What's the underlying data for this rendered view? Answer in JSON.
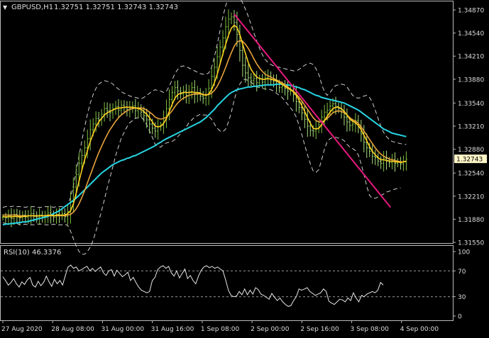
{
  "window": {
    "symbol_label": "GBPUSD,H1",
    "ohlc_label": "1.32751 1.32751 1.32743 1.32743",
    "triangle_glyph": "▼"
  },
  "chart_data": [
    {
      "type": "line",
      "title": "GBPUSD,H1 1.32751 1.32751 1.32743 1.32743",
      "x_tick_labels": [
        "27 Aug 2020",
        "28 Aug 08:00",
        "31 Aug 00:00",
        "31 Aug 16:00",
        "1 Sep 08:00",
        "2 Sep 00:00",
        "2 Sep 16:00",
        "3 Sep 08:00",
        "4 Sep 00:00"
      ],
      "y_tick_labels": [
        "1.34870",
        "1.34540",
        "1.34210",
        "1.33880",
        "1.33540",
        "1.33210",
        "1.32880",
        "1.32540",
        "1.32210",
        "1.31880",
        "1.31550"
      ],
      "ylim": [
        1.3155,
        1.3487
      ],
      "current_price_label": "1.32743",
      "series": [],
      "price_close": [
        1.3191,
        1.319,
        1.3193,
        1.3189,
        1.3195,
        1.3192,
        1.319,
        1.3194,
        1.3191,
        1.3193,
        1.3196,
        1.3192,
        1.3191,
        1.3194,
        1.319,
        1.3193,
        1.3197,
        1.3194,
        1.3191,
        1.3195,
        1.3193,
        1.3196,
        1.3192,
        1.3199,
        1.3213,
        1.3234,
        1.3252,
        1.3268,
        1.3279,
        1.329,
        1.3303,
        1.3316,
        1.3324,
        1.3332,
        1.333,
        1.3338,
        1.3346,
        1.3343,
        1.334,
        1.3346,
        1.3349,
        1.3344,
        1.3351,
        1.3348,
        1.3345,
        1.3347,
        1.335,
        1.3343,
        1.3346,
        1.3341,
        1.3336,
        1.333,
        1.3324,
        1.3318,
        1.3314,
        1.332,
        1.3322,
        1.3333,
        1.3346,
        1.3359,
        1.3369,
        1.3376,
        1.3371,
        1.3367,
        1.3371,
        1.3365,
        1.3369,
        1.3376,
        1.3366,
        1.3369,
        1.3364,
        1.3361,
        1.3366,
        1.3375,
        1.3392,
        1.3405,
        1.342,
        1.3434,
        1.3447,
        1.3463,
        1.3474,
        1.3477,
        1.3469,
        1.3452,
        1.3429,
        1.3408,
        1.3397,
        1.339,
        1.3386,
        1.3389,
        1.3383,
        1.3388,
        1.3384,
        1.339,
        1.3392,
        1.3387,
        1.3385,
        1.3381,
        1.3376,
        1.3378,
        1.3375,
        1.3371,
        1.3372,
        1.3366,
        1.3356,
        1.3348,
        1.334,
        1.3331,
        1.3321,
        1.3315,
        1.3314,
        1.3318,
        1.3323,
        1.3334,
        1.3341,
        1.3344,
        1.335,
        1.3353,
        1.3349,
        1.3346,
        1.3341,
        1.3334,
        1.3327,
        1.3322,
        1.3324,
        1.3329,
        1.332,
        1.331,
        1.3298,
        1.329,
        1.3285,
        1.3278,
        1.3276,
        1.3271,
        1.3268,
        1.3275,
        1.3271,
        1.3269,
        1.3273,
        1.3268,
        1.327,
        1.3267,
        1.327,
        1.3274
      ],
      "sma_fast": [
        1.3192,
        1.3191,
        1.3192,
        1.3191,
        1.3192,
        1.3192,
        1.3191,
        1.3192,
        1.3192,
        1.3193,
        1.3193,
        1.3193,
        1.3193,
        1.3193,
        1.3193,
        1.3193,
        1.3194,
        1.3194,
        1.3193,
        1.3194,
        1.3194,
        1.3194,
        1.3194,
        1.3196,
        1.32,
        1.321,
        1.3225,
        1.3242,
        1.3258,
        1.3273,
        1.3286,
        1.3299,
        1.331,
        1.332,
        1.3327,
        1.3332,
        1.3337,
        1.334,
        1.3342,
        1.3344,
        1.3346,
        1.3347,
        1.3347,
        1.3348,
        1.3348,
        1.3348,
        1.3348,
        1.3347,
        1.3346,
        1.3345,
        1.3342,
        1.3338,
        1.3333,
        1.3327,
        1.3321,
        1.332,
        1.3321,
        1.3325,
        1.3332,
        1.3342,
        1.3352,
        1.3361,
        1.3366,
        1.3368,
        1.3369,
        1.3369,
        1.3369,
        1.337,
        1.3369,
        1.3369,
        1.3368,
        1.3366,
        1.3365,
        1.3367,
        1.3373,
        1.3383,
        1.3395,
        1.341,
        1.3424,
        1.3438,
        1.3451,
        1.3461,
        1.3465,
        1.3462,
        1.3452,
        1.3438,
        1.3425,
        1.3412,
        1.3402,
        1.3396,
        1.3391,
        1.3389,
        1.3388,
        1.3388,
        1.3389,
        1.3388,
        1.3387,
        1.3386,
        1.3383,
        1.3381,
        1.3378,
        1.3375,
        1.3373,
        1.337,
        1.3365,
        1.3358,
        1.335,
        1.3342,
        1.3333,
        1.3325,
        1.3318,
        1.3317,
        1.3318,
        1.3323,
        1.3329,
        1.3335,
        1.3341,
        1.3346,
        1.3348,
        1.3348,
        1.3346,
        1.3342,
        1.3337,
        1.3331,
        1.3328,
        1.3326,
        1.3322,
        1.3316,
        1.3308,
        1.33,
        1.3292,
        1.3285,
        1.328,
        1.3276,
        1.3273,
        1.3273,
        1.3272,
        1.3271,
        1.3271,
        1.327,
        1.327,
        1.3269,
        1.327,
        1.3271
      ],
      "sma_slow": [
        1.3194,
        1.3194,
        1.3194,
        1.3194,
        1.3194,
        1.3194,
        1.3193,
        1.3193,
        1.3193,
        1.3193,
        1.3193,
        1.3193,
        1.3193,
        1.3193,
        1.3193,
        1.3193,
        1.3193,
        1.3193,
        1.3193,
        1.3193,
        1.3193,
        1.3193,
        1.3193,
        1.3194,
        1.3195,
        1.3198,
        1.3203,
        1.321,
        1.3219,
        1.3229,
        1.324,
        1.3251,
        1.3262,
        1.3273,
        1.3283,
        1.3292,
        1.3301,
        1.3309,
        1.3316,
        1.3322,
        1.3328,
        1.3333,
        1.3337,
        1.334,
        1.3343,
        1.3345,
        1.3346,
        1.3347,
        1.3347,
        1.3347,
        1.3346,
        1.3344,
        1.3341,
        1.3338,
        1.3334,
        1.3332,
        1.3331,
        1.3332,
        1.3334,
        1.3338,
        1.3343,
        1.3349,
        1.3354,
        1.3358,
        1.3361,
        1.3363,
        1.3365,
        1.3366,
        1.3367,
        1.3367,
        1.3367,
        1.3366,
        1.3366,
        1.3366,
        1.3368,
        1.3372,
        1.3378,
        1.3386,
        1.3395,
        1.3405,
        1.3416,
        1.3426,
        1.3435,
        1.3441,
        1.3443,
        1.3442,
        1.3438,
        1.3432,
        1.3425,
        1.3417,
        1.341,
        1.3404,
        1.3399,
        1.3395,
        1.3393,
        1.3391,
        1.3389,
        1.3387,
        1.3385,
        1.3383,
        1.338,
        1.3377,
        1.3374,
        1.3371,
        1.3367,
        1.3362,
        1.3357,
        1.3351,
        1.3345,
        1.3339,
        1.3333,
        1.3329,
        1.3327,
        1.3327,
        1.3329,
        1.3332,
        1.3336,
        1.334,
        1.3342,
        1.3343,
        1.3342,
        1.334,
        1.3337,
        1.3333,
        1.333,
        1.3328,
        1.3325,
        1.332,
        1.3314,
        1.3308,
        1.3302,
        1.3296,
        1.329,
        1.3285,
        1.3281,
        1.3278,
        1.3276,
        1.3274,
        1.3273,
        1.3272,
        1.3271,
        1.327,
        1.327,
        1.3271
      ],
      "ma_long": [
        1.318,
        1.3181,
        1.3181,
        1.3182,
        1.3182,
        1.3183,
        1.3183,
        1.3184,
        1.3184,
        1.3185,
        1.3186,
        1.3187,
        1.3188,
        1.3189,
        1.319,
        1.3191,
        1.3192,
        1.3194,
        1.3196,
        1.3198,
        1.32,
        1.3203,
        1.3206,
        1.3209,
        1.3212,
        1.3215,
        1.3218,
        1.3222,
        1.3226,
        1.323,
        1.3234,
        1.3238,
        1.3242,
        1.3246,
        1.325,
        1.3254,
        1.3257,
        1.326,
        1.3263,
        1.3266,
        1.3268,
        1.327,
        1.3272,
        1.3273,
        1.3275,
        1.3276,
        1.3278,
        1.3279,
        1.3281,
        1.3283,
        1.3285,
        1.3287,
        1.3289,
        1.3291,
        1.3293,
        1.3296,
        1.3298,
        1.3301,
        1.3303,
        1.3305,
        1.3307,
        1.3309,
        1.3311,
        1.3313,
        1.3315,
        1.3317,
        1.3319,
        1.3321,
        1.3323,
        1.3325,
        1.3327,
        1.333,
        1.3333,
        1.3337,
        1.3341,
        1.3345,
        1.335,
        1.3354,
        1.3358,
        1.3362,
        1.3366,
        1.3369,
        1.3371,
        1.3373,
        1.3374,
        1.3375,
        1.3376,
        1.3377,
        1.3377,
        1.3378,
        1.3378,
        1.3379,
        1.3379,
        1.338,
        1.338,
        1.338,
        1.338,
        1.3381,
        1.3381,
        1.3381,
        1.338,
        1.338,
        1.3379,
        1.3378,
        1.3377,
        1.3376,
        1.3374,
        1.3373,
        1.3371,
        1.3369,
        1.3367,
        1.3365,
        1.3364,
        1.3362,
        1.3361,
        1.336,
        1.3359,
        1.3358,
        1.3357,
        1.3356,
        1.3355,
        1.3354,
        1.3352,
        1.335,
        1.3348,
        1.3346,
        1.3344,
        1.3341,
        1.3338,
        1.3335,
        1.3332,
        1.3329,
        1.3326,
        1.3323,
        1.332,
        1.3317,
        1.3315,
        1.3313,
        1.3311,
        1.331,
        1.3309,
        1.3308,
        1.3307,
        1.3306
      ],
      "band_upper": [
        1.3205,
        1.3206,
        1.3207,
        1.3206,
        1.3207,
        1.3206,
        1.3206,
        1.3206,
        1.3205,
        1.3206,
        1.3206,
        1.3206,
        1.3205,
        1.3205,
        1.3205,
        1.3206,
        1.3206,
        1.3206,
        1.3205,
        1.3206,
        1.3206,
        1.3206,
        1.3205,
        1.3209,
        1.3219,
        1.3236,
        1.3256,
        1.3278,
        1.33,
        1.332,
        1.3338,
        1.3354,
        1.3366,
        1.3375,
        1.3381,
        1.3384,
        1.3386,
        1.3385,
        1.3384,
        1.3381,
        1.3377,
        1.3374,
        1.337,
        1.3368,
        1.3366,
        1.3364,
        1.3363,
        1.3362,
        1.3361,
        1.336,
        1.3362,
        1.3365,
        1.3368,
        1.3371,
        1.3373,
        1.3372,
        1.3371,
        1.3369,
        1.3371,
        1.3378,
        1.3387,
        1.3396,
        1.3402,
        1.3406,
        1.3407,
        1.3406,
        1.3404,
        1.3402,
        1.34,
        1.3398,
        1.3396,
        1.3395,
        1.3395,
        1.3397,
        1.3405,
        1.342,
        1.3438,
        1.3458,
        1.3477,
        1.3493,
        1.3505,
        1.3511,
        1.3512,
        1.351,
        1.3505,
        1.3497,
        1.3488,
        1.3478,
        1.3466,
        1.3454,
        1.3443,
        1.3432,
        1.3423,
        1.3416,
        1.3412,
        1.3409,
        1.3407,
        1.3406,
        1.3405,
        1.3404,
        1.3403,
        1.3402,
        1.3401,
        1.34,
        1.34,
        1.3402,
        1.3405,
        1.3408,
        1.341,
        1.3411,
        1.3409,
        1.3403,
        1.3395,
        1.3381,
        1.337,
        1.3365,
        1.3369,
        1.3375,
        1.3379,
        1.338,
        1.3381,
        1.338,
        1.3377,
        1.3371,
        1.3365,
        1.3362,
        1.3361,
        1.3362,
        1.3364,
        1.3365,
        1.3362,
        1.3355,
        1.3344,
        1.3332,
        1.3321,
        1.3312,
        1.3306,
        1.3302,
        1.3299,
        1.3298,
        1.3297,
        1.3296,
        1.3295,
        1.3295
      ],
      "band_lower": [
        1.3183,
        1.3182,
        1.3181,
        1.3182,
        1.3181,
        1.3182,
        1.318,
        1.318,
        1.3181,
        1.318,
        1.318,
        1.318,
        1.3181,
        1.3181,
        1.3181,
        1.318,
        1.318,
        1.318,
        1.3181,
        1.318,
        1.318,
        1.318,
        1.3181,
        1.3179,
        1.3171,
        1.316,
        1.315,
        1.3142,
        1.3138,
        1.3138,
        1.3142,
        1.3148,
        1.3158,
        1.3171,
        1.3185,
        1.32,
        1.3216,
        1.3233,
        1.3248,
        1.3263,
        1.3279,
        1.3292,
        1.3304,
        1.3312,
        1.332,
        1.3326,
        1.3329,
        1.3332,
        1.3333,
        1.3334,
        1.333,
        1.3323,
        1.3314,
        1.3305,
        1.3295,
        1.3292,
        1.3291,
        1.3295,
        1.3297,
        1.3298,
        1.3299,
        1.3302,
        1.3306,
        1.331,
        1.3315,
        1.332,
        1.3326,
        1.333,
        1.3334,
        1.3336,
        1.3338,
        1.3337,
        1.3337,
        1.3335,
        1.3331,
        1.3324,
        1.3318,
        1.3314,
        1.3313,
        1.3317,
        1.3327,
        1.3341,
        1.3358,
        1.3372,
        1.3381,
        1.3387,
        1.3388,
        1.3386,
        1.3384,
        1.338,
        1.3377,
        1.3376,
        1.3375,
        1.3374,
        1.3374,
        1.3373,
        1.3371,
        1.3368,
        1.3365,
        1.3362,
        1.3357,
        1.3352,
        1.3347,
        1.3342,
        1.3334,
        1.3322,
        1.3309,
        1.3294,
        1.328,
        1.3267,
        1.3257,
        1.3255,
        1.3259,
        1.3273,
        1.3288,
        1.3299,
        1.3303,
        1.3305,
        1.3305,
        1.3304,
        1.3303,
        1.33,
        1.3295,
        1.3291,
        1.3289,
        1.3286,
        1.328,
        1.3267,
        1.3252,
        1.3235,
        1.3222,
        1.3218,
        1.3218,
        1.322,
        1.3222,
        1.3224,
        1.3227,
        1.3228,
        1.323,
        1.3231,
        1.3232,
        1.3233
      ],
      "trendline": {
        "from": [
          82,
          1.3481
        ],
        "to": [
          147,
          1.3205
        ]
      }
    },
    {
      "type": "line",
      "title": "RSI(10) 46.3376",
      "y_tick_labels": [
        "100",
        "70",
        "30",
        "0"
      ],
      "ylim": [
        0,
        100
      ],
      "levels": [
        70,
        30
      ],
      "series": [],
      "values": [
        61,
        55,
        48,
        52,
        58,
        50,
        45,
        53,
        49,
        56,
        60,
        48,
        45,
        54,
        47,
        52,
        62,
        53,
        46,
        57,
        50,
        55,
        48,
        63,
        76,
        79,
        74,
        76,
        70,
        72,
        75,
        77,
        70,
        74,
        69,
        73,
        76,
        67,
        63,
        70,
        72,
        62,
        71,
        66,
        61,
        64,
        68,
        55,
        60,
        52,
        45,
        40,
        38,
        36,
        38,
        55,
        60,
        72,
        76,
        78,
        74,
        77,
        67,
        62,
        70,
        59,
        66,
        73,
        58,
        63,
        55,
        50,
        62,
        71,
        76,
        78,
        75,
        77,
        74,
        76,
        73,
        70,
        56,
        40,
        32,
        30,
        31,
        38,
        33,
        42,
        33,
        40,
        34,
        44,
        41,
        34,
        32,
        29,
        26,
        35,
        29,
        24,
        28,
        22,
        18,
        15,
        16,
        24,
        30,
        42,
        40,
        42,
        44,
        38,
        35,
        32,
        34,
        36,
        42,
        38,
        23,
        20,
        18,
        22,
        26,
        25,
        22,
        28,
        24,
        36,
        28,
        22,
        32,
        30,
        34,
        36,
        38,
        36,
        40,
        52,
        48
      ]
    }
  ],
  "colors": {
    "background": "#000000",
    "axis": "#bbbbbb",
    "text": "#dddddd",
    "bull_bar": "#7fbf3f",
    "bear_bar": "#a8e07c",
    "sma_fast": "#ffd21f",
    "sma_slow": "#e8a33a",
    "ma_long": "#27d4e3",
    "bands": "#cfcfcf",
    "trendline": "#e5197e",
    "rsi": "#e6e6e6",
    "price_box": "#fff6c8"
  }
}
